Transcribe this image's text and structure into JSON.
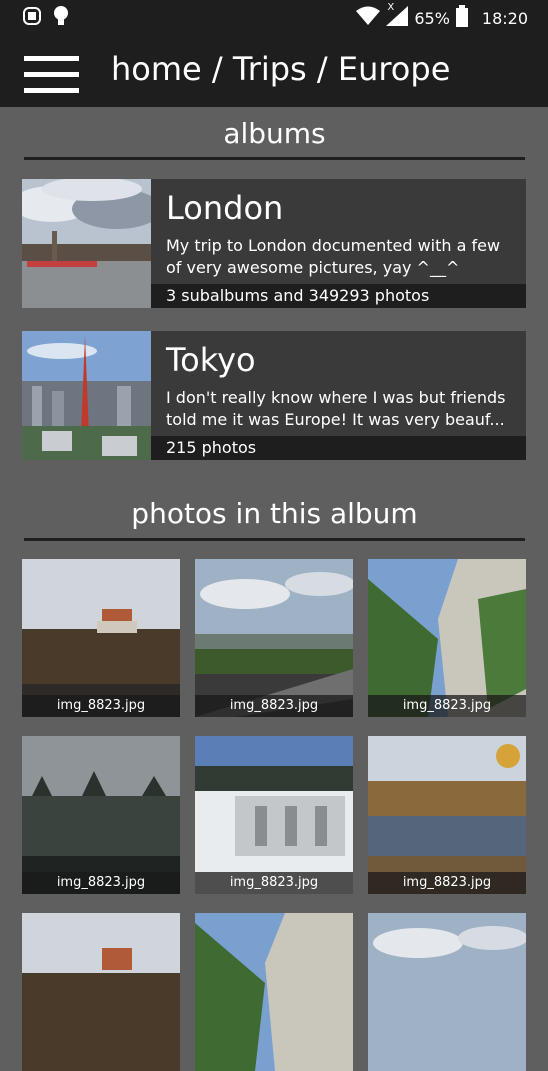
{
  "statusbar": {
    "battery": "65%",
    "time": "18:20",
    "network_label": "X"
  },
  "toolbar": {
    "title": "home / Trips / Europe"
  },
  "albums_section": {
    "heading": "albums",
    "items": [
      {
        "name": "London",
        "description": "My trip to London documented with a few of very awesome pictures, yay ^__^",
        "count": "3 subalbums and 349293 photos"
      },
      {
        "name": "Tokyo",
        "description": "I don't really know where I was but friends told me it was Europe! It was very beauf...",
        "count": "215 photos"
      }
    ]
  },
  "photos_section": {
    "heading": "photos in this album",
    "items": [
      {
        "filename": "img_8823.jpg"
      },
      {
        "filename": "img_8823.jpg"
      },
      {
        "filename": "img_8823.jpg"
      },
      {
        "filename": "img_8823.jpg"
      },
      {
        "filename": "img_8823.jpg"
      },
      {
        "filename": "img_8823.jpg"
      }
    ]
  },
  "icons": [
    "app-icon",
    "lightbulb-icon",
    "wifi-icon",
    "signal-icon",
    "battery-icon",
    "menu-icon"
  ]
}
